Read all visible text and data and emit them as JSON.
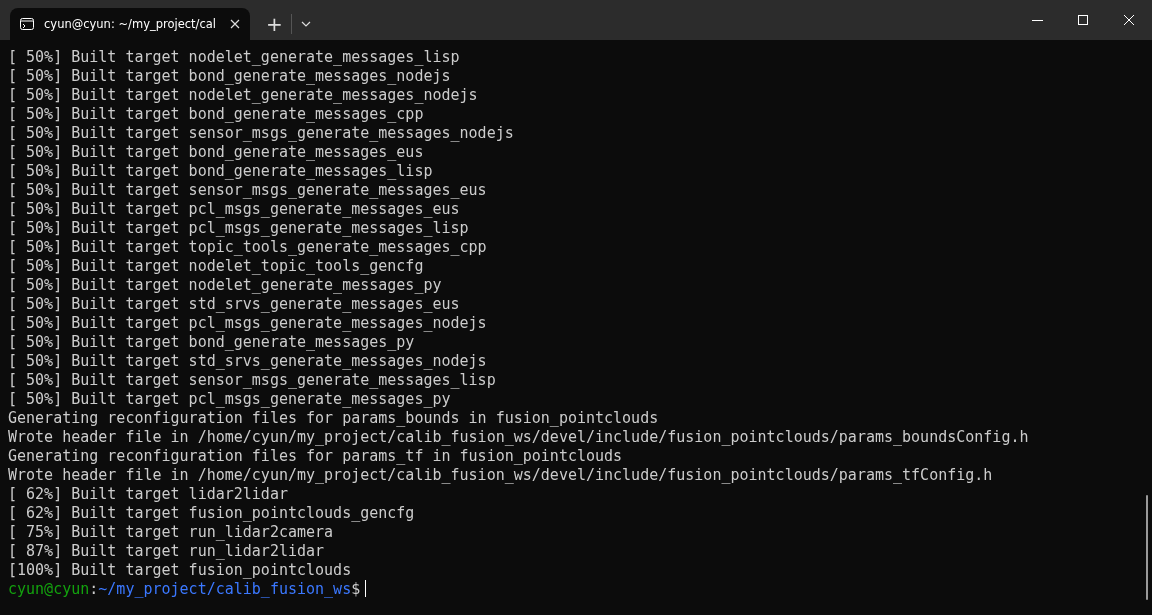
{
  "window": {
    "tabs": [
      {
        "title": "cyun@cyun: ~/my_project/cal",
        "selected": true
      }
    ],
    "new_tab": "+"
  },
  "terminal": {
    "lines": [
      "[ 50%] Built target nodelet_generate_messages_lisp",
      "[ 50%] Built target bond_generate_messages_nodejs",
      "[ 50%] Built target nodelet_generate_messages_nodejs",
      "[ 50%] Built target bond_generate_messages_cpp",
      "[ 50%] Built target sensor_msgs_generate_messages_nodejs",
      "[ 50%] Built target bond_generate_messages_eus",
      "[ 50%] Built target bond_generate_messages_lisp",
      "[ 50%] Built target sensor_msgs_generate_messages_eus",
      "[ 50%] Built target pcl_msgs_generate_messages_eus",
      "[ 50%] Built target pcl_msgs_generate_messages_lisp",
      "[ 50%] Built target topic_tools_generate_messages_cpp",
      "[ 50%] Built target nodelet_topic_tools_gencfg",
      "[ 50%] Built target nodelet_generate_messages_py",
      "[ 50%] Built target std_srvs_generate_messages_eus",
      "[ 50%] Built target pcl_msgs_generate_messages_nodejs",
      "[ 50%] Built target bond_generate_messages_py",
      "[ 50%] Built target std_srvs_generate_messages_nodejs",
      "[ 50%] Built target sensor_msgs_generate_messages_lisp",
      "[ 50%] Built target pcl_msgs_generate_messages_py",
      "Generating reconfiguration files for params_bounds in fusion_pointclouds",
      "Wrote header file in /home/cyun/my_project/calib_fusion_ws/devel/include/fusion_pointclouds/params_boundsConfig.h",
      "Generating reconfiguration files for params_tf in fusion_pointclouds",
      "Wrote header file in /home/cyun/my_project/calib_fusion_ws/devel/include/fusion_pointclouds/params_tfConfig.h",
      "[ 62%] Built target lidar2lidar",
      "[ 62%] Built target fusion_pointclouds_gencfg",
      "[ 75%] Built target run_lidar2camera",
      "[ 87%] Built target run_lidar2lidar",
      "[100%] Built target fusion_pointclouds"
    ],
    "prompt": {
      "user": "cyun@cyun",
      "separator": ":",
      "path": "~/my_project/calib_fusion_ws",
      "symbol": "$"
    }
  }
}
